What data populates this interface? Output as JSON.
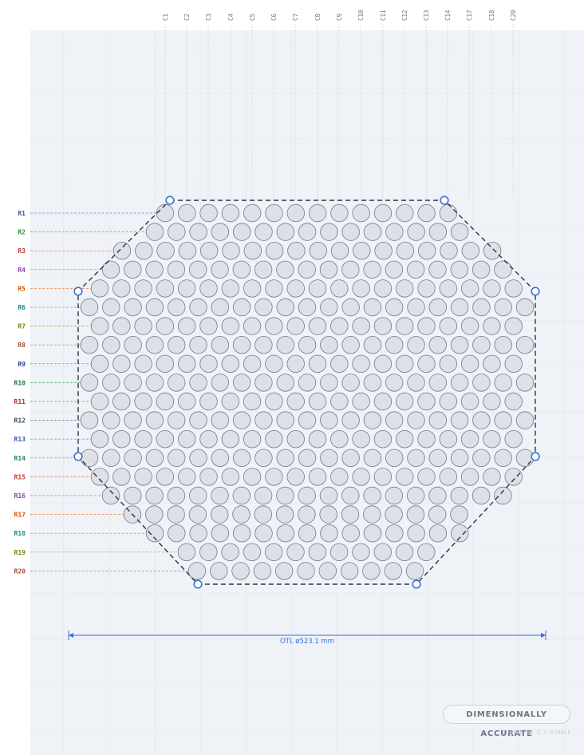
{
  "columns": [
    "C1",
    "C2",
    "C3",
    "C4",
    "C5",
    "C6",
    "C7",
    "C8",
    "C9",
    "C10",
    "C11",
    "C12",
    "C13",
    "C14",
    "C17",
    "C18",
    "C20"
  ],
  "rows": [
    {
      "label": "R1",
      "color": "#3a57a8"
    },
    {
      "label": "R2",
      "color": "#2f8a4a"
    },
    {
      "label": "R3",
      "color": "#c0392b"
    },
    {
      "label": "R4",
      "color": "#8e44ad"
    },
    {
      "label": "R5",
      "color": "#d35400"
    },
    {
      "label": "R6",
      "color": "#16878a"
    },
    {
      "label": "R7",
      "color": "#6d8a1a"
    },
    {
      "label": "R8",
      "color": "#a0522d"
    },
    {
      "label": "R9",
      "color": "#2c3e99"
    },
    {
      "label": "R10",
      "color": "#1e7a36"
    },
    {
      "label": "R11",
      "color": "#a93226"
    },
    {
      "label": "R12",
      "color": "#34495e"
    },
    {
      "label": "R13",
      "color": "#3a57a8"
    },
    {
      "label": "R14",
      "color": "#1e8a50"
    },
    {
      "label": "R15",
      "color": "#c0392b"
    },
    {
      "label": "R16",
      "color": "#8e44ad"
    },
    {
      "label": "R17",
      "color": "#d35400"
    },
    {
      "label": "R18",
      "color": "#16878a"
    },
    {
      "label": "R19",
      "color": "#6d8a1a"
    },
    {
      "label": "R20",
      "color": "#a0522d"
    }
  ],
  "dimension_label": "OTL ø523.1 mm",
  "badge_label": "DIMENSIONALLY ACCURATE",
  "engine_label": "ENGINE V4.2.1-STABLE",
  "colors": {
    "accent": "#3d6fd6",
    "tube_fill": "#dde1e7",
    "tube_stroke": "#6f7b8a",
    "outline": "#2c3342",
    "panel_bg": "#eff2f7"
  }
}
